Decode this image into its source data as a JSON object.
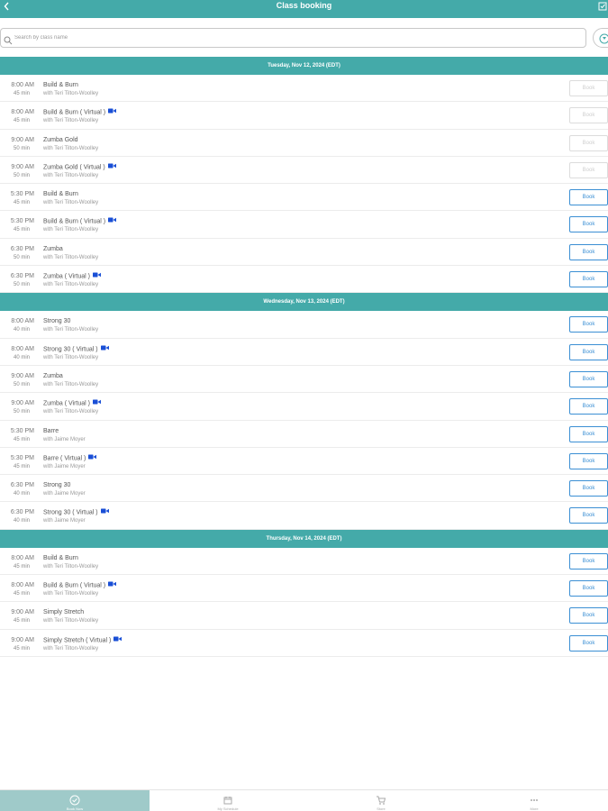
{
  "header": {
    "title": "Class booking"
  },
  "search": {
    "placeholder": "Search by class name"
  },
  "days": [
    {
      "date": "Tuesday, Nov 12, 2024 (EDT)",
      "classes": [
        {
          "time": "8:00 AM",
          "duration": "45 min",
          "name": "Build & Burn",
          "virtual": false,
          "instructor": "with Teri Tilton-Woolley",
          "book": "Book",
          "enabled": false
        },
        {
          "time": "8:00 AM",
          "duration": "45 min",
          "name": "Build & Burn ( Virtual )",
          "virtual": true,
          "instructor": "with Teri Tilton-Woolley",
          "book": "Book",
          "enabled": false
        },
        {
          "time": "9:00 AM",
          "duration": "50 min",
          "name": "Zumba Gold",
          "virtual": false,
          "instructor": "with Teri Tilton-Woolley",
          "book": "Book",
          "enabled": false
        },
        {
          "time": "9:00 AM",
          "duration": "50 min",
          "name": "Zumba Gold ( Virtual )",
          "virtual": true,
          "instructor": "with Teri Tilton-Woolley",
          "book": "Book",
          "enabled": false
        },
        {
          "time": "5:30 PM",
          "duration": "45 min",
          "name": "Build & Burn",
          "virtual": false,
          "instructor": "with Teri Tilton-Woolley",
          "book": "Book",
          "enabled": true
        },
        {
          "time": "5:30 PM",
          "duration": "45 min",
          "name": "Build & Burn ( Virtual )",
          "virtual": true,
          "instructor": "with Teri Tilton-Woolley",
          "book": "Book",
          "enabled": true
        },
        {
          "time": "6:30 PM",
          "duration": "50 min",
          "name": "Zumba",
          "virtual": false,
          "instructor": "with Teri Tilton-Woolley",
          "book": "Book",
          "enabled": true
        },
        {
          "time": "6:30 PM",
          "duration": "50 min",
          "name": "Zumba ( Virtual )",
          "virtual": true,
          "instructor": "with Teri Tilton-Woolley",
          "book": "Book",
          "enabled": true
        }
      ]
    },
    {
      "date": "Wednesday, Nov 13, 2024 (EDT)",
      "classes": [
        {
          "time": "8:00 AM",
          "duration": "40 min",
          "name": "Strong 30",
          "virtual": false,
          "instructor": "with Teri Tilton-Woolley",
          "book": "Book",
          "enabled": true
        },
        {
          "time": "8:00 AM",
          "duration": "40 min",
          "name": "Strong 30 ( Virtual )",
          "virtual": true,
          "instructor": "with Teri Tilton-Woolley",
          "book": "Book",
          "enabled": true
        },
        {
          "time": "9:00 AM",
          "duration": "50 min",
          "name": "Zumba",
          "virtual": false,
          "instructor": "with Teri Tilton-Woolley",
          "book": "Book",
          "enabled": true
        },
        {
          "time": "9:00 AM",
          "duration": "50 min",
          "name": "Zumba ( Virtual )",
          "virtual": true,
          "instructor": "with Teri Tilton-Woolley",
          "book": "Book",
          "enabled": true
        },
        {
          "time": "5:30 PM",
          "duration": "45 min",
          "name": "Barre",
          "virtual": false,
          "instructor": "with Jaime Moyer",
          "book": "Book",
          "enabled": true
        },
        {
          "time": "5:30 PM",
          "duration": "45 min",
          "name": "Barre ( Virtual )",
          "virtual": true,
          "instructor": "with Jaime Moyer",
          "book": "Book",
          "enabled": true
        },
        {
          "time": "6:30 PM",
          "duration": "40 min",
          "name": "Strong 30",
          "virtual": false,
          "instructor": "with Jaime Moyer",
          "book": "Book",
          "enabled": true
        },
        {
          "time": "6:30 PM",
          "duration": "40 min",
          "name": "Strong 30 ( Virtual )",
          "virtual": true,
          "instructor": "with Jaime Moyer",
          "book": "Book",
          "enabled": true
        }
      ]
    },
    {
      "date": "Thursday, Nov 14, 2024 (EDT)",
      "classes": [
        {
          "time": "8:00 AM",
          "duration": "45 min",
          "name": "Build & Burn",
          "virtual": false,
          "instructor": "with Teri Tilton-Woolley",
          "book": "Book",
          "enabled": true
        },
        {
          "time": "8:00 AM",
          "duration": "45 min",
          "name": "Build & Burn ( Virtual )",
          "virtual": true,
          "instructor": "with Teri Tilton-Woolley",
          "book": "Book",
          "enabled": true
        },
        {
          "time": "9:00 AM",
          "duration": "45 min",
          "name": "Simply Stretch",
          "virtual": false,
          "instructor": "with Teri Tilton-Woolley",
          "book": "Book",
          "enabled": true
        },
        {
          "time": "9:00 AM",
          "duration": "45 min",
          "name": "Simply Stretch ( Virtual )",
          "virtual": true,
          "instructor": "with Teri Tilton-Woolley",
          "book": "Book",
          "enabled": true
        }
      ]
    }
  ],
  "tabs": [
    {
      "label": "Book Now",
      "icon": "check-circle-icon",
      "active": true
    },
    {
      "label": "My Schedule",
      "icon": "calendar-icon",
      "active": false
    },
    {
      "label": "Store",
      "icon": "cart-icon",
      "active": false
    },
    {
      "label": "More",
      "icon": "more-icon",
      "active": false
    }
  ],
  "colors": {
    "header": "#44aaa9",
    "active_tab": "#9fcac9",
    "book_border": "#3b8fd4",
    "virtual_icon": "#1a4fd6"
  }
}
